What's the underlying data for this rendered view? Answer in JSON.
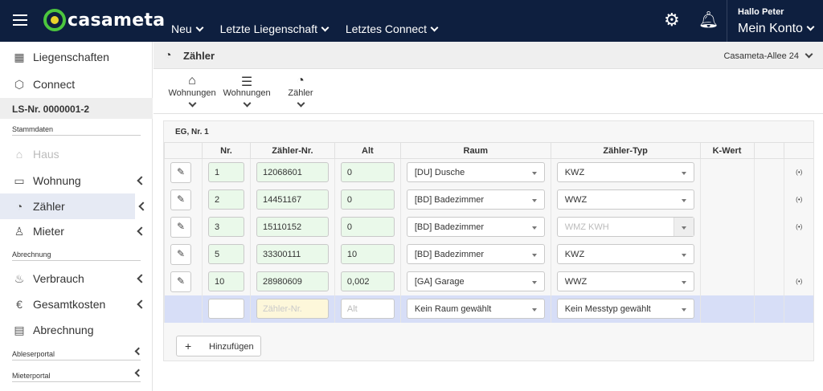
{
  "topbar": {
    "logo_text": "casameta",
    "nav": [
      "Neu",
      "Letzte Liegenschaft",
      "Letztes Connect"
    ],
    "greeting": "Hallo Peter",
    "account": "Mein Konto"
  },
  "sidebar": {
    "top_items": [
      {
        "label": "Liegenschaften",
        "icon": "buildings-icon"
      },
      {
        "label": "Connect",
        "icon": "cube-icon"
      }
    ],
    "property_id": "LS-Nr. 0000001-2",
    "section_stammdaten": "Stammdaten",
    "stamm_items": [
      {
        "label": "Haus",
        "icon": "house-icon",
        "disabled": true
      },
      {
        "label": "Wohnung",
        "icon": "sofa-icon"
      },
      {
        "label": "Zähler",
        "icon": "meter-icon",
        "active": true
      },
      {
        "label": "Mieter",
        "icon": "person-icon"
      }
    ],
    "section_abrechnung": "Abrechnung",
    "abr_items": [
      {
        "label": "Verbrauch",
        "icon": "flame-icon"
      },
      {
        "label": "Gesamtkosten",
        "icon": "euro-icon"
      },
      {
        "label": "Abrechnung",
        "icon": "document-icon"
      }
    ],
    "section_ableserportal": "Ableserportal",
    "section_mieterportal": "Mieterportal"
  },
  "main": {
    "title": "Zähler",
    "address": "Casameta-Allee 24",
    "toolbar": [
      "Wohnungen",
      "Wohnungen",
      "Zähler"
    ],
    "panel_title": "EG, Nr. 1",
    "columns": [
      "Nr.",
      "Zähler-Nr.",
      "Alt",
      "Raum",
      "Zähler-Typ",
      "K-Wert"
    ],
    "rows": [
      {
        "nr": "1",
        "zaehler_nr": "12068601",
        "alt": "0",
        "raum": "[DU] Dusche",
        "typ": "KWZ",
        "typ_disabled": false,
        "signal": true
      },
      {
        "nr": "2",
        "zaehler_nr": "14451167",
        "alt": "0",
        "raum": "[BD] Badezimmer",
        "typ": "WWZ",
        "typ_disabled": false,
        "signal": true
      },
      {
        "nr": "3",
        "zaehler_nr": "15110152",
        "alt": "0",
        "raum": "[BD] Badezimmer",
        "typ": "WMZ KWH",
        "typ_disabled": true,
        "signal": true
      },
      {
        "nr": "5",
        "zaehler_nr": "33300111",
        "alt": "10",
        "raum": "[BD] Badezimmer",
        "typ": "KWZ",
        "typ_disabled": false,
        "signal": false
      },
      {
        "nr": "10",
        "zaehler_nr": "28980609",
        "alt": "0,002",
        "raum": "[GA] Garage",
        "typ": "WWZ",
        "typ_disabled": false,
        "signal": true
      }
    ],
    "new_row": {
      "zaehler_placeholder": "Zähler-Nr.",
      "alt_placeholder": "Alt",
      "raum": "Kein Raum gewählt",
      "typ": "Kein Messtyp gewählt"
    },
    "add_button": "Hinzufügen"
  }
}
